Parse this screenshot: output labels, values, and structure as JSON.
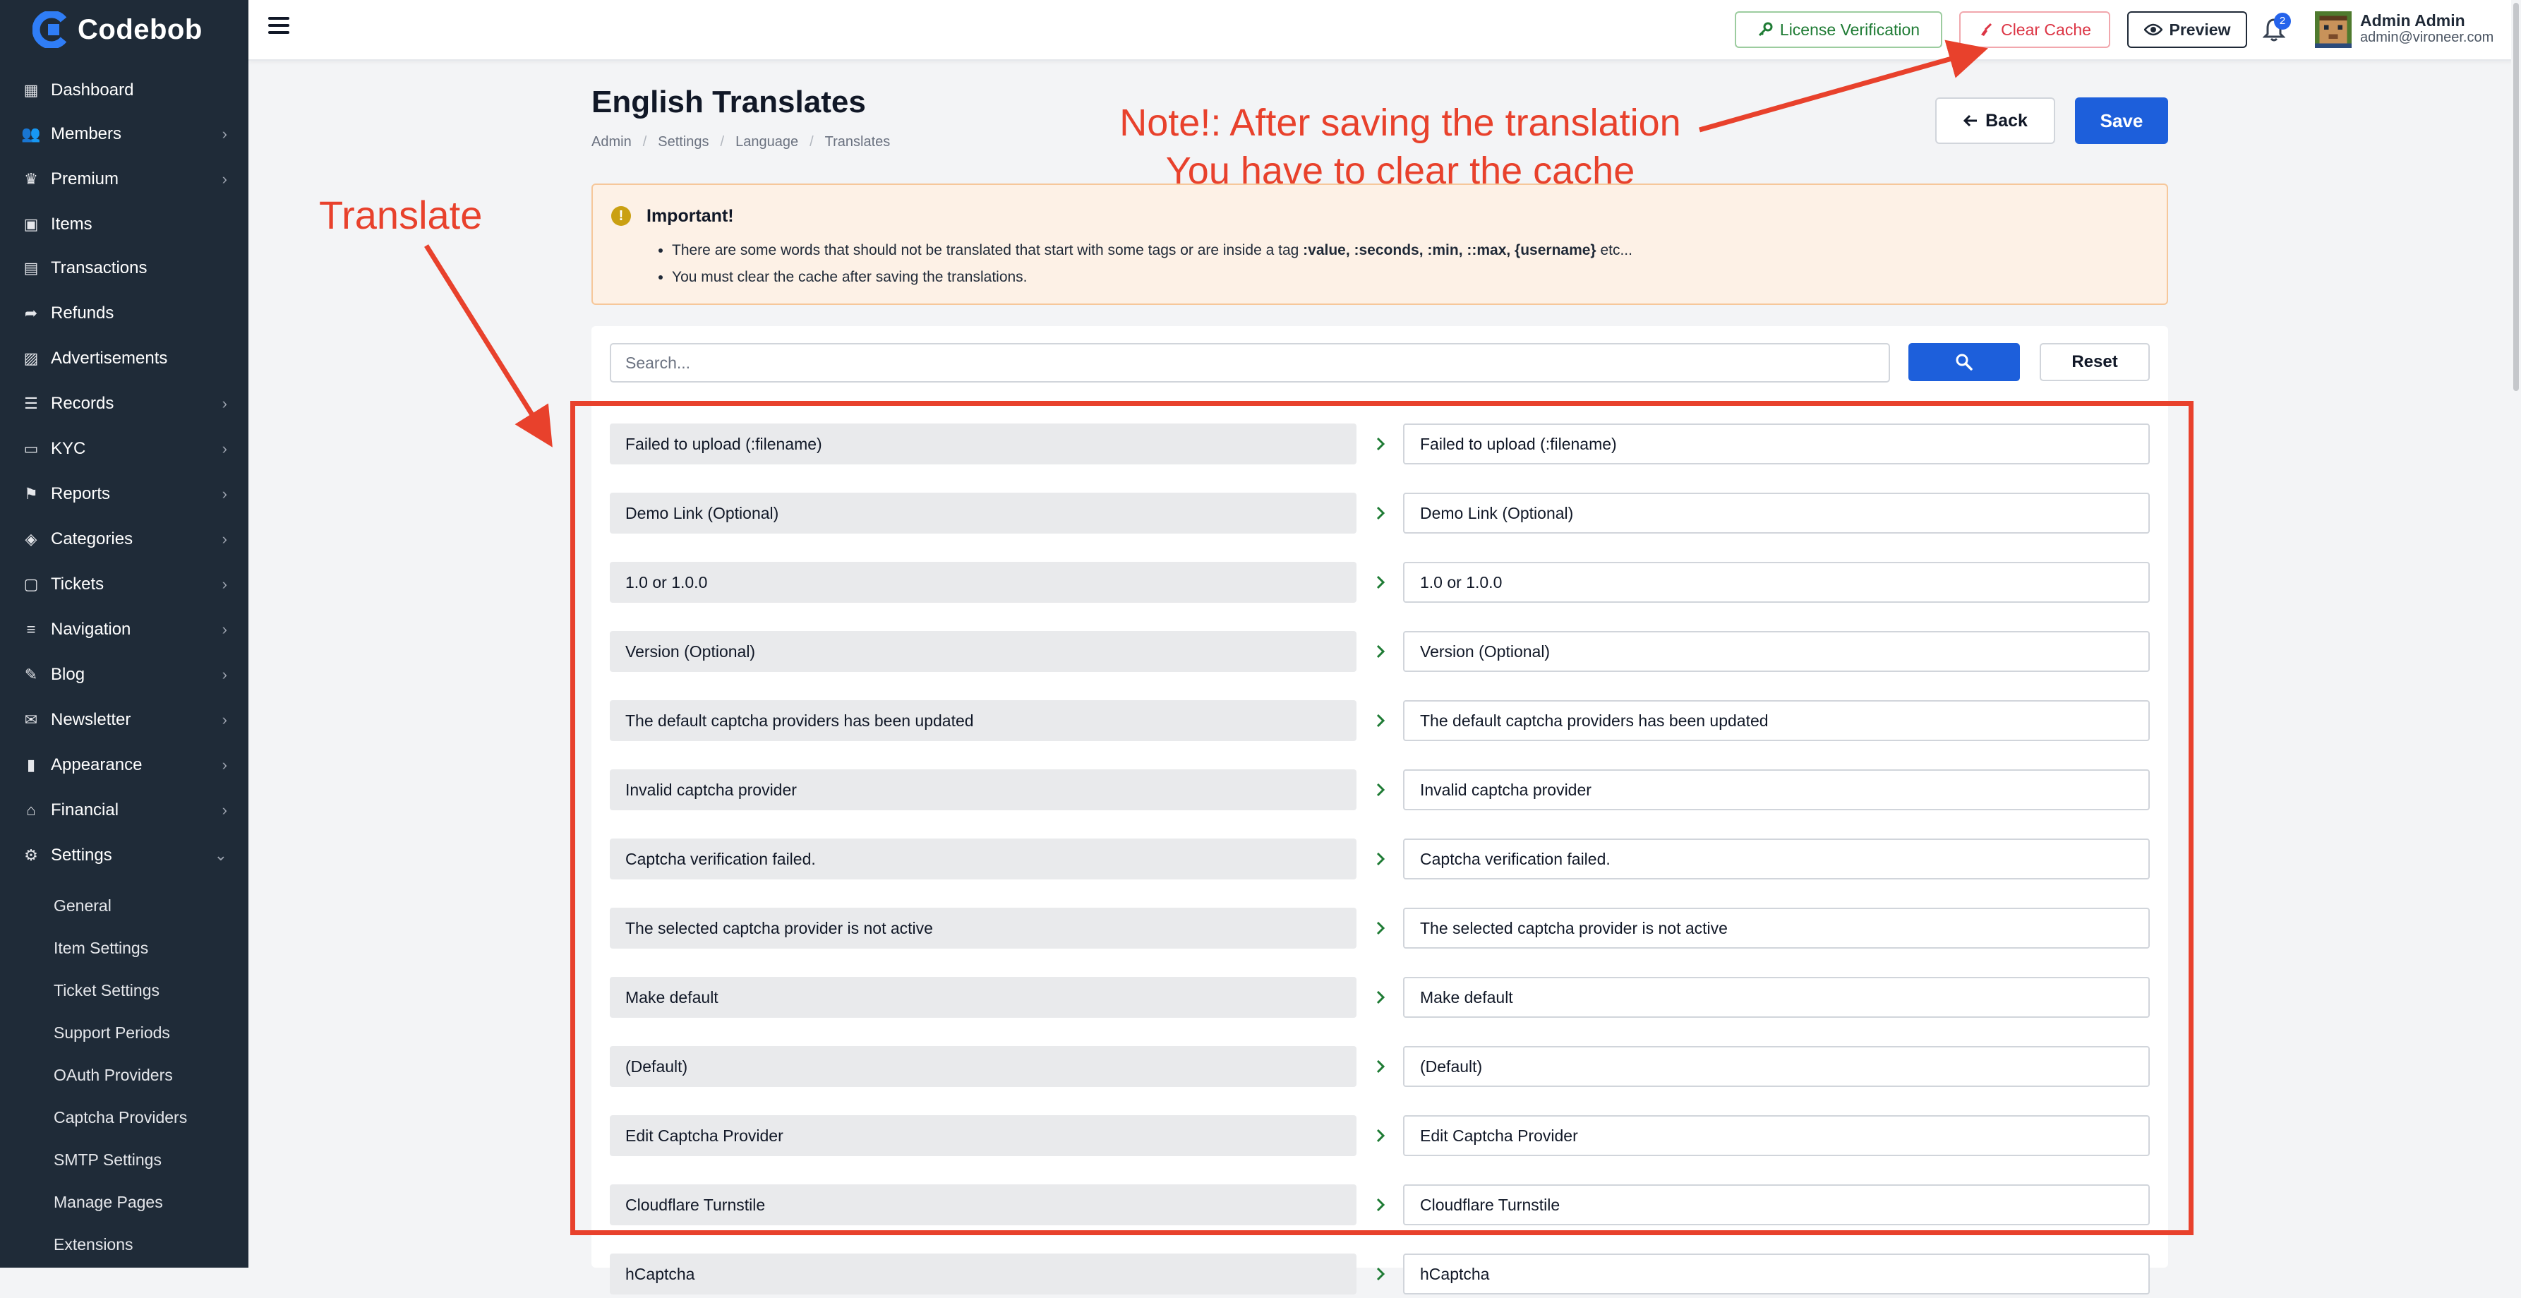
{
  "brand": {
    "name": "Codebob",
    "accent": "#2563eb"
  },
  "sidebar": {
    "items": [
      {
        "label": "Dashboard",
        "icon": "dashboard-icon",
        "chevron": false
      },
      {
        "label": "Members",
        "icon": "users-icon",
        "chevron": true
      },
      {
        "label": "Premium",
        "icon": "crown-icon",
        "chevron": true
      },
      {
        "label": "Items",
        "icon": "box-icon",
        "chevron": false
      },
      {
        "label": "Transactions",
        "icon": "receipt-icon",
        "chevron": false
      },
      {
        "label": "Refunds",
        "icon": "share-icon",
        "chevron": false
      },
      {
        "label": "Advertisements",
        "icon": "image-icon",
        "chevron": false
      },
      {
        "label": "Records",
        "icon": "database-icon",
        "chevron": true
      },
      {
        "label": "KYC",
        "icon": "id-card-icon",
        "chevron": true
      },
      {
        "label": "Reports",
        "icon": "flag-icon",
        "chevron": true
      },
      {
        "label": "Categories",
        "icon": "tags-icon",
        "chevron": true
      },
      {
        "label": "Tickets",
        "icon": "inbox-icon",
        "chevron": true
      },
      {
        "label": "Navigation",
        "icon": "bars-icon",
        "chevron": true
      },
      {
        "label": "Blog",
        "icon": "blog-icon",
        "chevron": true
      },
      {
        "label": "Newsletter",
        "icon": "envelope-icon",
        "chevron": true
      },
      {
        "label": "Appearance",
        "icon": "brush-icon",
        "chevron": true
      },
      {
        "label": "Financial",
        "icon": "bank-icon",
        "chevron": true
      },
      {
        "label": "Settings",
        "icon": "gear-icon",
        "chevron": true,
        "expanded": true
      }
    ],
    "settings_sub": [
      "General",
      "Item Settings",
      "Ticket Settings",
      "Support Periods",
      "OAuth Providers",
      "Captcha Providers",
      "SMTP Settings",
      "Manage Pages",
      "Extensions"
    ]
  },
  "topbar": {
    "license_label": "License Verification",
    "clear_cache_label": "Clear Cache",
    "preview_label": "Preview",
    "notification_count": "2",
    "user_name": "Admin Admin",
    "user_email": "admin@vironeer.com"
  },
  "page": {
    "title": "English Translates",
    "breadcrumbs": [
      "Admin",
      "Settings",
      "Language",
      "Translates"
    ],
    "back_label": "Back",
    "save_label": "Save"
  },
  "alert": {
    "title": "Important!",
    "line1_prefix": "There are some words that should not be translated that start with some tags or are inside a tag ",
    "line1_tags": ":value, :seconds, :min, ::max, {username}",
    "line1_suffix": " etc...",
    "line2": "You must clear the cache after saving the translations."
  },
  "search": {
    "placeholder": "Search...",
    "reset_label": "Reset"
  },
  "translations": [
    {
      "source": "Failed to upload (:filename)",
      "target": "Failed to upload (:filename)"
    },
    {
      "source": "Demo Link (Optional)",
      "target": "Demo Link (Optional)"
    },
    {
      "source": "1.0 or 1.0.0",
      "target": "1.0 or 1.0.0"
    },
    {
      "source": "Version (Optional)",
      "target": "Version (Optional)"
    },
    {
      "source": "The default captcha providers has been updated",
      "target": "The default captcha providers has been updated"
    },
    {
      "source": "Invalid captcha provider",
      "target": "Invalid captcha provider"
    },
    {
      "source": "Captcha verification failed.",
      "target": "Captcha verification failed."
    },
    {
      "source": "The selected captcha provider is not active",
      "target": "The selected captcha provider is not active"
    },
    {
      "source": "Make default",
      "target": "Make default"
    },
    {
      "source": "(Default)",
      "target": "(Default)"
    },
    {
      "source": "Edit Captcha Provider",
      "target": "Edit Captcha Provider"
    },
    {
      "source": "Cloudflare Turnstile",
      "target": "Cloudflare Turnstile"
    },
    {
      "source": "hCaptcha",
      "target": "hCaptcha"
    }
  ],
  "annotations": {
    "note_line1": "Note!: After saving the translation",
    "note_line2": "You have to clear the cache",
    "translate_label": "Translate",
    "color": "#e8412c"
  }
}
